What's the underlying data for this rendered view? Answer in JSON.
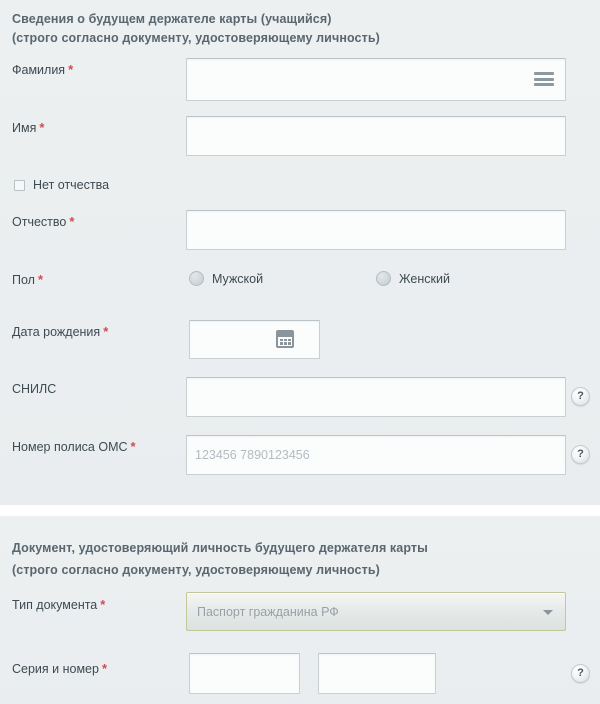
{
  "section_personal": {
    "heading_line1": "Сведения о будущем держателе карты (учащийся)",
    "heading_line2": "(строго согласно документу, удостоверяющему личность)",
    "fields": {
      "surname": {
        "label": "Фамилия",
        "required": "*",
        "value": "",
        "placeholder": ""
      },
      "firstname": {
        "label": "Имя",
        "required": "*",
        "value": "",
        "placeholder": ""
      },
      "no_patronymic": {
        "label": "Нет отчества",
        "checked": false
      },
      "patronymic": {
        "label": "Отчество",
        "required": "*",
        "value": "",
        "placeholder": ""
      },
      "gender": {
        "label": "Пол",
        "required": "*",
        "options": [
          {
            "label": "Мужской",
            "selected": false
          },
          {
            "label": "Женский",
            "selected": false
          }
        ]
      },
      "birthdate": {
        "label": "Дата рождения",
        "required": "*",
        "value": "",
        "placeholder": ""
      },
      "snils": {
        "label": "СНИЛС",
        "required": "",
        "value": "",
        "placeholder": ""
      },
      "oms": {
        "label": "Номер полиса ОМС",
        "required": "*",
        "value": "",
        "placeholder": "123456 7890123456"
      }
    },
    "help_labels": {
      "snils": "?",
      "oms": "?"
    }
  },
  "section_document": {
    "heading_line1": "Документ, удостоверяющий личность будущего держателя карты",
    "heading_line2": "(строго согласно документу, удостоверяющему личность)",
    "fields": {
      "doc_type": {
        "label": "Тип документа",
        "required": "*",
        "selected": "Паспорт гражданина РФ"
      },
      "series_number": {
        "label": "Серия и номер",
        "required": "*",
        "series_value": "",
        "number_value": "",
        "series_placeholder": "",
        "number_placeholder": ""
      }
    },
    "help_labels": {
      "series_number": "?"
    }
  },
  "colors": {
    "panel_bg": "#ebeef0",
    "required_mark": "#d14b52",
    "heading_text": "#5a6670",
    "label_text": "#3e4a52",
    "input_bg": "#fbfcfc",
    "input_border": "#c9d0d4",
    "select_border": "#c3c79a",
    "placeholder_text": "#b4bcc2"
  },
  "icons": {
    "surname_picker": "hamburger-icon",
    "birthdate_picker": "calendar-icon",
    "doc_type_arrow": "chevron-down-icon"
  }
}
